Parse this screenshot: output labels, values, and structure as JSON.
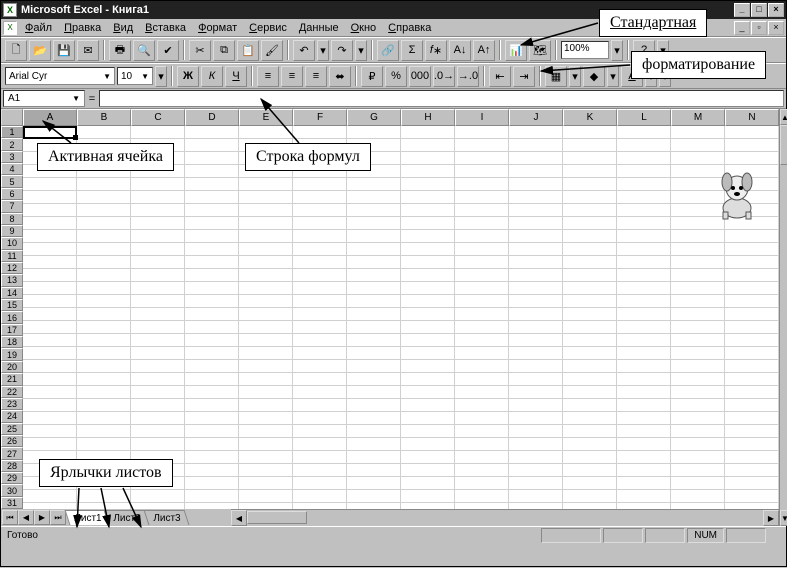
{
  "title": "Microsoft Excel - Книга1",
  "menus": [
    "Файл",
    "Правка",
    "Вид",
    "Вставка",
    "Формат",
    "Сервис",
    "Данные",
    "Окно",
    "Справка"
  ],
  "toolbar1": {
    "zoom": "100%"
  },
  "format": {
    "font": "Arial Cyr",
    "size": "10"
  },
  "name_box": "A1",
  "columns": [
    "A",
    "B",
    "C",
    "D",
    "E",
    "F",
    "G",
    "H",
    "I",
    "J",
    "K",
    "L",
    "M",
    "N"
  ],
  "row_count": 31,
  "sheets": [
    "Лист1",
    "Лист2",
    "Лист3"
  ],
  "status": {
    "ready": "Готово",
    "num": "NUM"
  },
  "callouts": {
    "standard": "Стандартная",
    "formatting": "форматирование",
    "active_cell": "Активная ячейка",
    "formula_row": "Строка формул",
    "sheet_tabs": "Ярлычки листов"
  }
}
